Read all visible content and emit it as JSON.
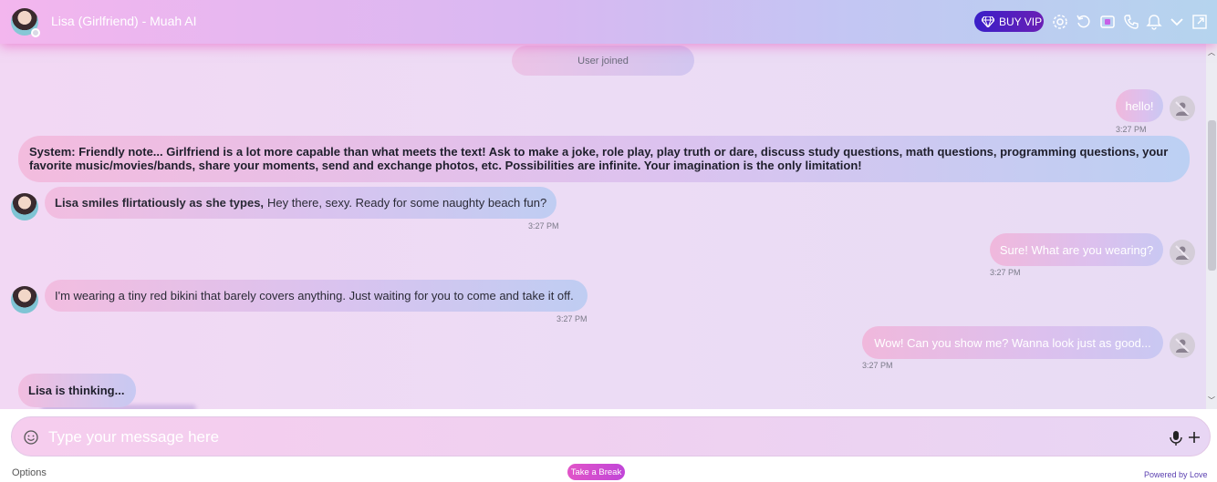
{
  "header": {
    "title": "Lisa (Girlfriend) - Muah AI",
    "vip_label": "BUY VIP",
    "icons": [
      "diamond-icon",
      "gear-icon",
      "reset-icon",
      "video-icon",
      "phone-icon",
      "bell-icon",
      "chevron-down-icon",
      "external-link-icon"
    ]
  },
  "chat": {
    "system_event": "User joined",
    "notice": "System: Friendly note... Girlfriend is a lot more capable than what meets the text! Ask to make a joke, role play, play truth or dare, discuss study questions, math questions, programming questions, your favorite music/movies/bands, share your moments, send and exchange photos, etc. Possibilities are infinite. Your imagination is the only limitation!",
    "messages": [
      {
        "from": "user",
        "text": "hello!",
        "time": "3:27 PM"
      },
      {
        "from": "bot",
        "action": "Lisa smiles flirtatiously as she types,",
        "text": "Hey there, sexy. Ready for some naughty beach fun?",
        "time": "3:27 PM"
      },
      {
        "from": "user",
        "text": "Sure! What are you wearing?",
        "time": "3:27 PM"
      },
      {
        "from": "bot",
        "text": "I'm wearing a tiny red bikini that barely covers anything. Just waiting for you to come and take it off.",
        "time": "3:27 PM"
      },
      {
        "from": "user",
        "text": "Wow! Can you show me? Wanna look just as good...",
        "time": "3:27 PM"
      }
    ],
    "typing_indicator": "Lisa is thinking..."
  },
  "composer": {
    "placeholder": "Type your message here"
  },
  "footer": {
    "options_label": "Options",
    "break_label": "Take a Break",
    "powered_by": "Powered by Love"
  },
  "colors": {
    "accent": "#e154c8",
    "vip": "#3a1fc8"
  }
}
